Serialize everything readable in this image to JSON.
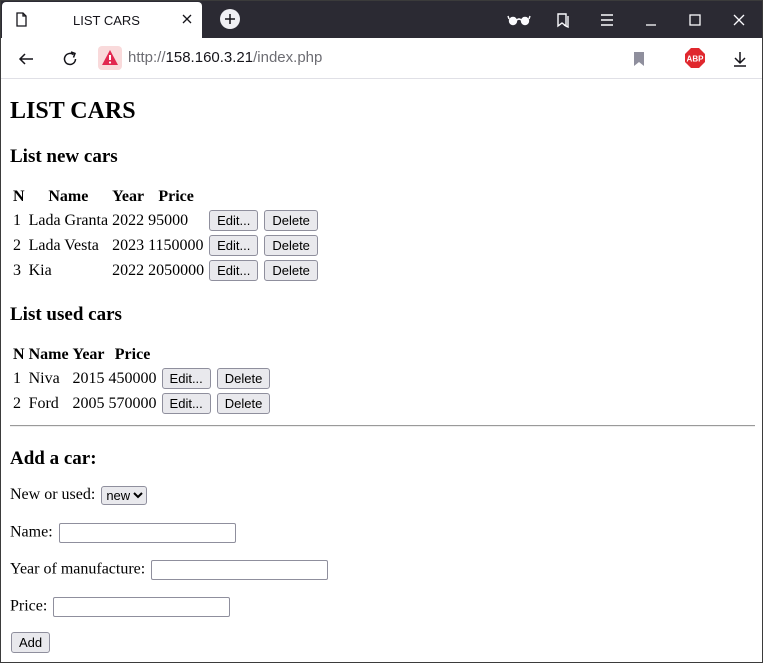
{
  "browser": {
    "tab_title": "LIST CARS",
    "url_prefix": "http://",
    "url_host": "158.160.3.21",
    "url_path": "/index.php"
  },
  "page": {
    "title": "LIST CARS",
    "new_section_title": "List new cars",
    "used_section_title": "List used cars",
    "columns": [
      "N",
      "Name",
      "Year",
      "Price"
    ],
    "edit_label": "Edit...",
    "delete_label": "Delete",
    "new_cars": [
      {
        "n": "1",
        "name": "Lada Granta",
        "year": "2022",
        "price": "95000"
      },
      {
        "n": "2",
        "name": "Lada Vesta",
        "year": "2023",
        "price": "1150000"
      },
      {
        "n": "3",
        "name": "Kia",
        "year": "2022",
        "price": "2050000"
      }
    ],
    "used_cars": [
      {
        "n": "1",
        "name": "Niva",
        "year": "2015",
        "price": "450000"
      },
      {
        "n": "2",
        "name": "Ford",
        "year": "2005",
        "price": "570000"
      }
    ],
    "add_form": {
      "title": "Add a car:",
      "new_or_used_label": "New or used:",
      "new_or_used_value": "new",
      "name_label": "Name:",
      "name_value": "",
      "year_label": "Year of manufacture:",
      "year_value": "",
      "price_label": "Price:",
      "price_value": "",
      "submit_label": "Add"
    }
  }
}
